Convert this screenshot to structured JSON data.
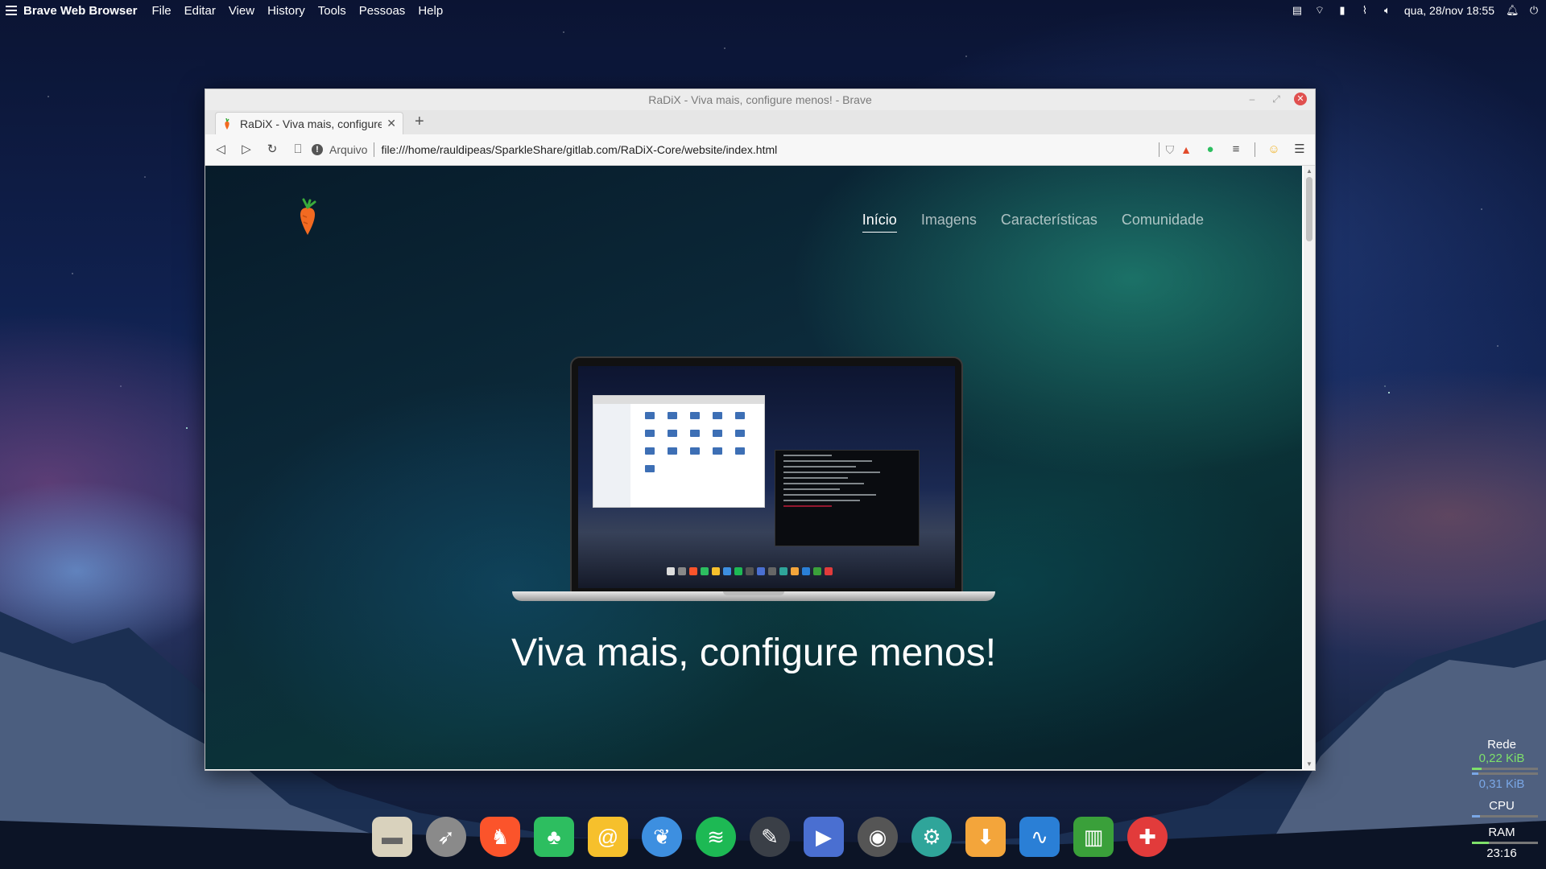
{
  "desktop": {
    "app_name": "Brave Web Browser",
    "menu": [
      "File",
      "Editar",
      "View",
      "History",
      "Tools",
      "Pessoas",
      "Help"
    ],
    "clock": "qua, 28/nov  18:55"
  },
  "window": {
    "title": "RaDiX - Viva mais, configure menos! - Brave",
    "tab_title": "RaDiX - Viva mais, configure menos!",
    "new_tab": "+",
    "url_scheme_label": "Arquivo",
    "url": "file:///home/rauldipeas/SparkleShare/gitlab.com/RaDiX-Core/website/index.html"
  },
  "page": {
    "nav": [
      "Início",
      "Imagens",
      "Características",
      "Comunidade"
    ],
    "active_nav": "Início",
    "headline": "Viva mais, configure menos!"
  },
  "dock": {
    "icons": [
      "files-icon",
      "launcher-rocket-icon",
      "brave-icon",
      "evernote-icon",
      "mail-icon",
      "bird-app-icon",
      "spotify-icon",
      "codeblocks-icon",
      "presentation-icon",
      "owl-app-icon",
      "settings-app-icon",
      "download-icon",
      "monitor-wave-icon",
      "trash-icon",
      "help-lifebuoy-icon"
    ],
    "colors": [
      "#d9d2bd",
      "#8a8a8a",
      "#fb542b",
      "#2dbe60",
      "#f6c02c",
      "#3d8fe0",
      "#1db954",
      "#3a3f47",
      "#4a6fd1",
      "#555",
      "#2fa59a",
      "#f3a53b",
      "#2a7fd6",
      "#3aa03a",
      "#e23b3b"
    ]
  },
  "conky": {
    "net_label": "Rede",
    "net_down": "0,22 KiB",
    "net_up": "0,31 KiB",
    "cpu_label": "CPU",
    "ram_label": "RAM",
    "uptime": "23:16"
  }
}
